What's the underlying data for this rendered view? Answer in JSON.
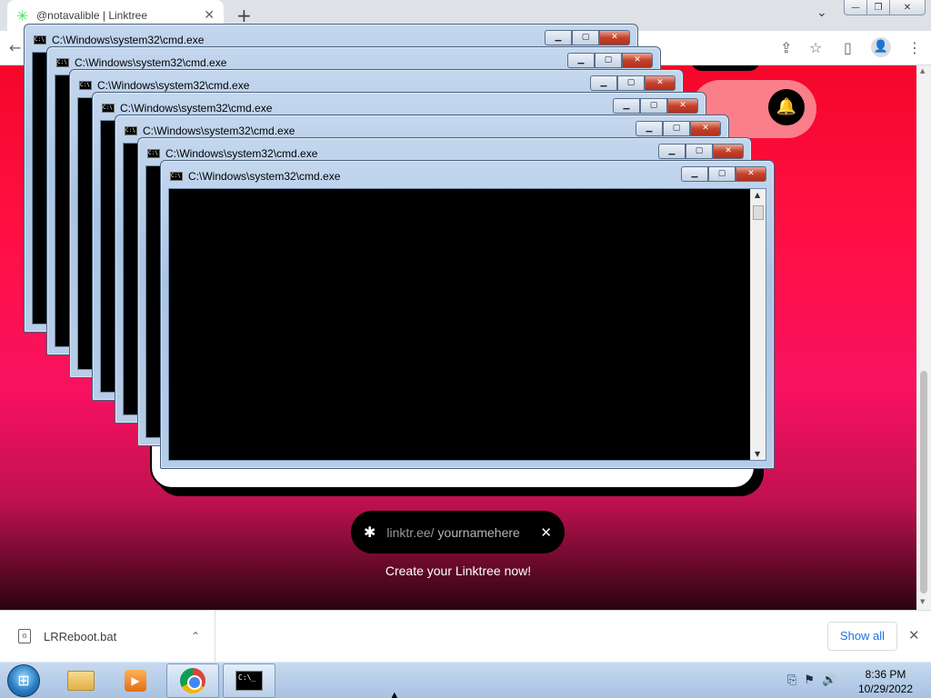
{
  "browser": {
    "tab_title": "@notavalible | Linktree",
    "tab_favicon": "linktree-asterisk-icon",
    "new_tab_symbol": "+",
    "tab_list_symbol": "⌄",
    "window_buttons": {
      "minimize": "—",
      "maximize": "❐",
      "close": "✕"
    },
    "toolbar": {
      "back": "←",
      "share": "⇪",
      "bookmark": "☆",
      "side_panel": "▯",
      "profile": "👤",
      "menu": "⋮"
    }
  },
  "page": {
    "notification_icon": "🔔",
    "claim_bar": {
      "asterisk": "✱",
      "prefix": "linktr.ee/",
      "placeholder": "yournamehere",
      "close": "✕"
    },
    "cta_text": "Create your Linktree now!",
    "colors": {
      "brand_red": "#f5062a",
      "brand_pink": "#f71160"
    }
  },
  "cmd_windows": [
    {
      "title": "C:\\Windows\\system32\\cmd.exe"
    },
    {
      "title": "C:\\Windows\\system32\\cmd.exe"
    },
    {
      "title": "C:\\Windows\\system32\\cmd.exe"
    },
    {
      "title": "C:\\Windows\\system32\\cmd.exe"
    },
    {
      "title": "C:\\Windows\\system32\\cmd.exe"
    },
    {
      "title": "C:\\Windows\\system32\\cmd.exe"
    },
    {
      "title": "C:\\Windows\\system32\\cmd.exe"
    }
  ],
  "cmd_buttons": {
    "minimize": "▁",
    "maximize": "▢",
    "close": "✕"
  },
  "downloads": {
    "file_name": "LRReboot.bat",
    "chevron": "⌃",
    "show_all": "Show all",
    "close": "✕"
  },
  "taskbar": {
    "start_icon": "windows-orb",
    "items": [
      "explorer",
      "media-player",
      "chrome",
      "cmd"
    ],
    "cmd_icon_text": "C:\\_",
    "tray": [
      "⎘",
      "⚑",
      "🔊"
    ],
    "time": "8:36 PM",
    "date": "10/29/2022"
  }
}
